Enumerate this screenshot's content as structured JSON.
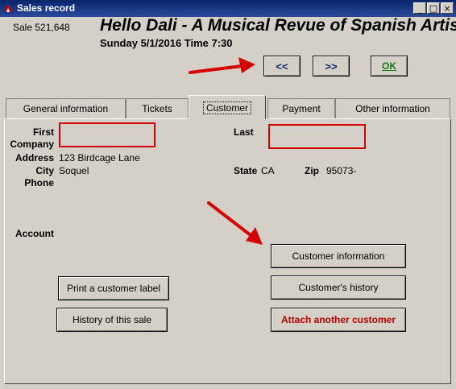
{
  "window": {
    "title": "Sales record",
    "min": "_",
    "max": "□",
    "close": "×"
  },
  "sale": {
    "label": "Sale 521,648"
  },
  "event": {
    "title": "Hello Dali - A Musical Revue of Spanish Artists",
    "datetime": "Sunday 5/1/2016  Time 7:30"
  },
  "nav": {
    "prev": "<<",
    "next": ">>",
    "ok": "OK"
  },
  "tabs": [
    "General information",
    "Tickets",
    "Customer",
    "Payment",
    "Other information"
  ],
  "form": {
    "first_label": "First",
    "company_label": "Company",
    "address_label": "Address",
    "address_value": "123 Birdcage Lane",
    "city_label": "City",
    "city_value": "Soquel",
    "phone_label": "Phone",
    "last_label": "Last",
    "state_label": "State",
    "state_value": "CA",
    "zip_label": "Zip",
    "zip_value": "95073-",
    "account_label": "Account"
  },
  "buttons": {
    "customer_info": "Customer information",
    "customer_history": "Customer's history",
    "attach_customer": "Attach another customer",
    "print_label": "Print a customer label",
    "sale_history": "History of this sale"
  },
  "colors": {
    "annotation": "#d40000",
    "title_bar": "#0a246a",
    "attach_text": "#b00000",
    "ok_text": "#1a7a1a"
  }
}
